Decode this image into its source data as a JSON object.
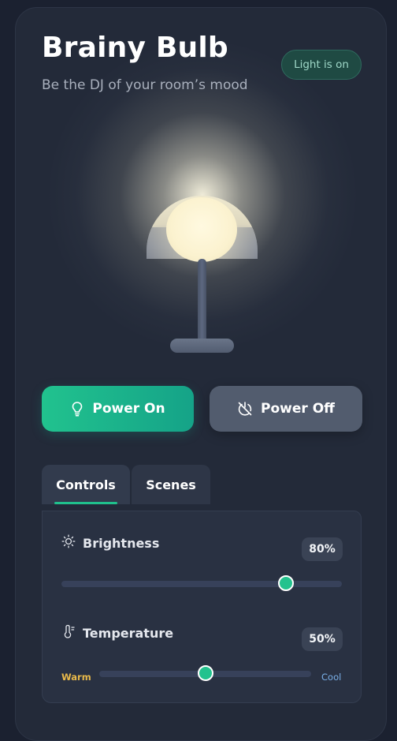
{
  "app": {
    "title": "Brainy Bulb",
    "subtitle": "Be the DJ of your room’s mood",
    "status_badge": "Light is on"
  },
  "buttons": {
    "power_on": "Power On",
    "power_off": "Power Off"
  },
  "tabs": [
    {
      "label": "Controls",
      "active": true
    },
    {
      "label": "Scenes",
      "active": false
    }
  ],
  "controls": {
    "brightness": {
      "label": "Brightness",
      "value_text": "80%",
      "level": 0.8,
      "icon": "sun-icon"
    },
    "temperature": {
      "label": "Temperature",
      "value_text": "50%",
      "level": 0.5,
      "icon": "thermometer-icon",
      "min_label": "Warm",
      "max_label": "Cool"
    }
  },
  "colors": {
    "accent": "#20c08c",
    "background": "#1b2130",
    "card": "#232a39",
    "warm": "#e8b94a",
    "cool": "#7ab0e8"
  },
  "icons": {
    "power_on": "lightbulb-icon",
    "power_off": "power-off-icon"
  }
}
